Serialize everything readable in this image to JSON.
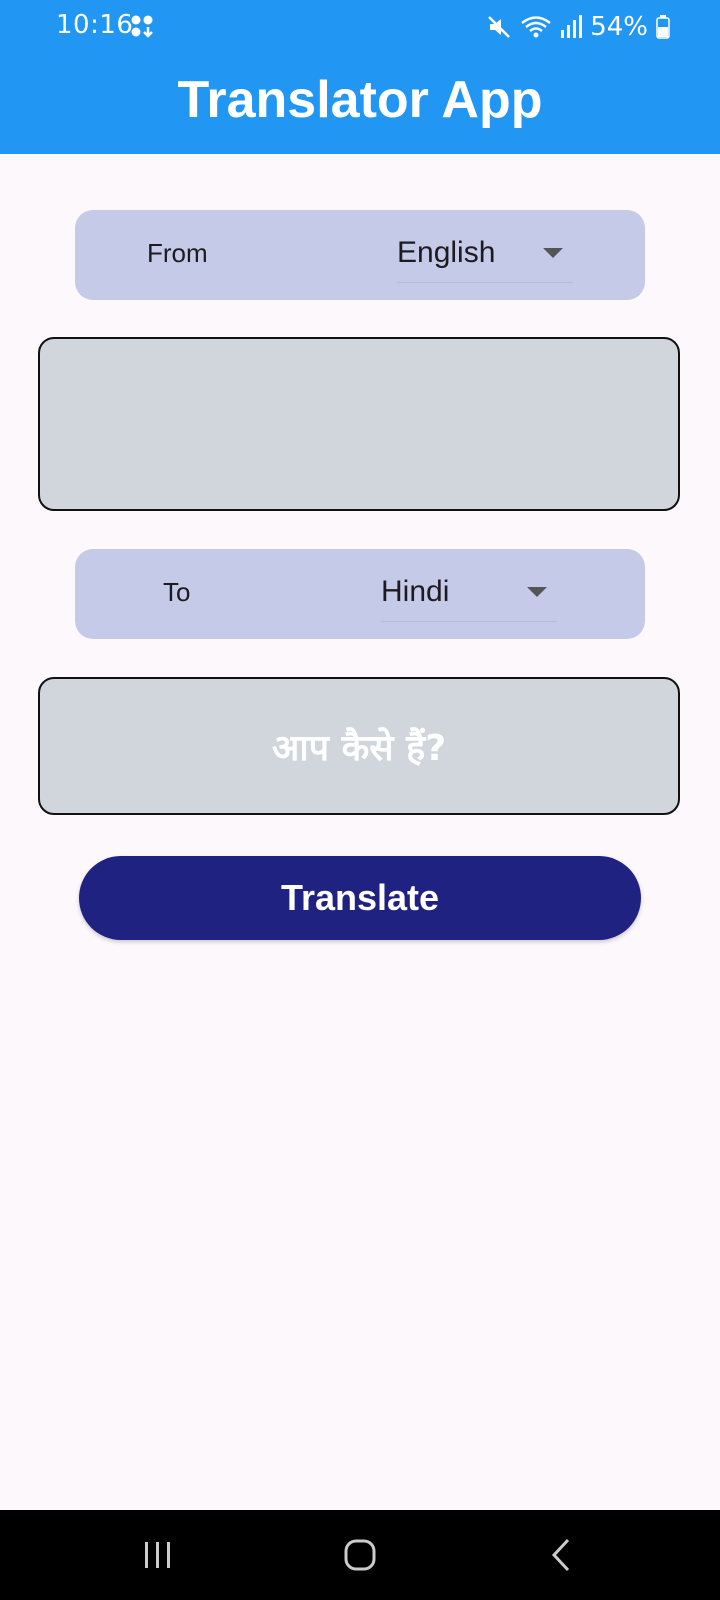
{
  "status_bar": {
    "time": "10:16",
    "battery": "54%",
    "icons": [
      "notification-icon",
      "mute-icon",
      "wifi-icon",
      "signal-icon",
      "battery-icon"
    ]
  },
  "app_bar": {
    "title": "Translator App",
    "color": "#2196f3"
  },
  "from_selector": {
    "label": "From",
    "selected": "English"
  },
  "source_input": {
    "value": "",
    "placeholder": ""
  },
  "to_selector": {
    "label": "To",
    "selected": "Hindi"
  },
  "output": {
    "text": "आप कैसे हैं?"
  },
  "translate_button": {
    "label": "Translate",
    "color": "#1f2280"
  },
  "nav_bar": {
    "icons": [
      "recent-apps-icon",
      "home-icon",
      "back-icon"
    ]
  }
}
